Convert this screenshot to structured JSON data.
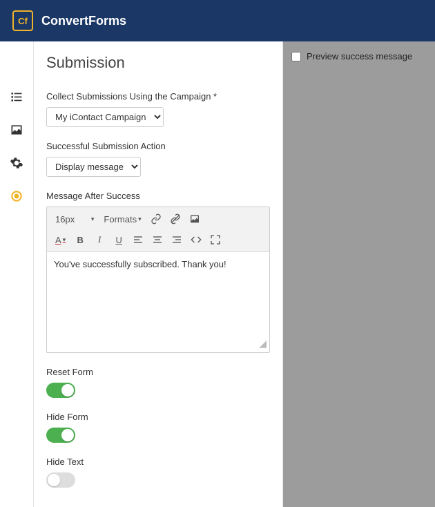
{
  "brand": "ConvertForms",
  "logo_text": "Cf",
  "sidebar": {
    "items": [
      {
        "name": "list-icon"
      },
      {
        "name": "image-icon"
      },
      {
        "name": "gear-icon"
      },
      {
        "name": "target-icon"
      }
    ]
  },
  "panel": {
    "title": "Submission",
    "campaign_label": "Collect Submissions Using the Campaign *",
    "campaign_value": "My iContact Campaign",
    "action_label": "Successful Submission Action",
    "action_value": "Display message",
    "message_label": "Message After Success",
    "editor": {
      "font_size": "16px",
      "formats_label": "Formats",
      "content": "You've successfully subscribed. Thank you!"
    },
    "reset_form_label": "Reset Form",
    "hide_form_label": "Hide Form",
    "hide_text_label": "Hide Text"
  },
  "preview": {
    "checkbox_label": "Preview success message"
  }
}
